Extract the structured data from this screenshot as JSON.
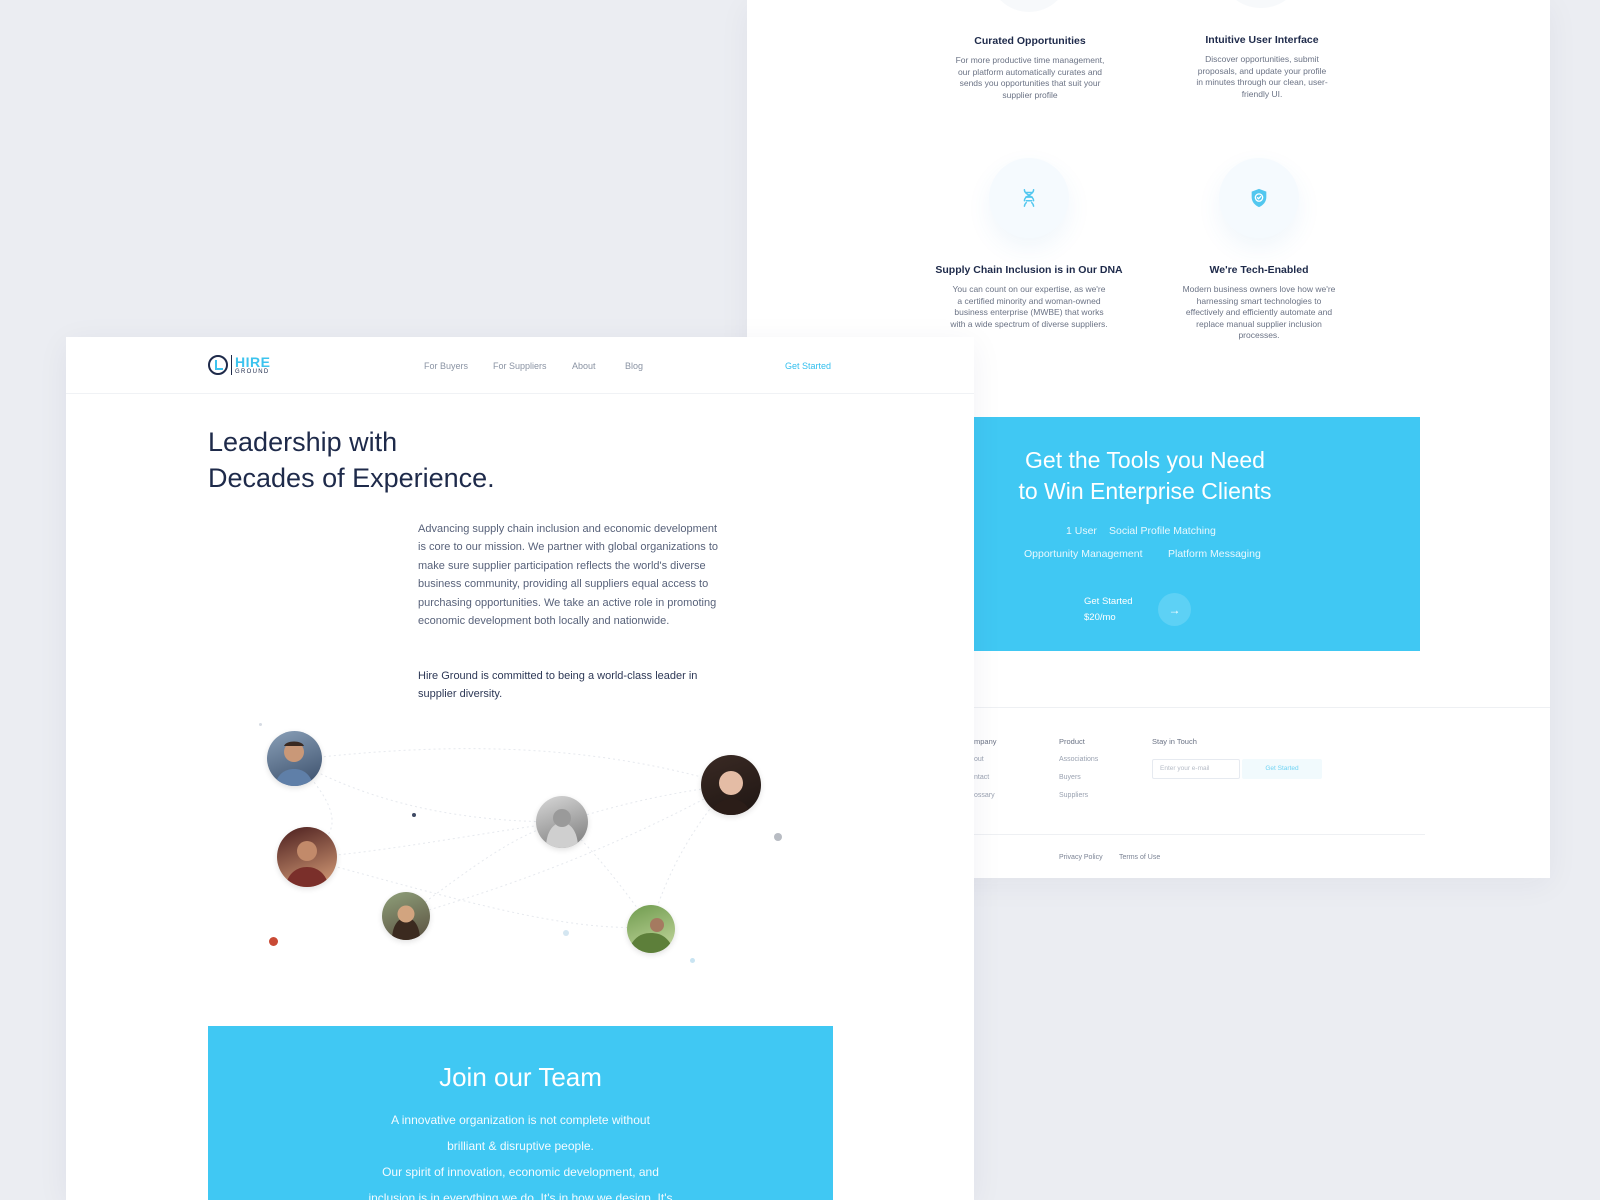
{
  "features": [
    {
      "title": "Curated Opportunities",
      "text": "For more productive time management, our platform automatically curates and sends you opportunities that suit your supplier profile"
    },
    {
      "title": "Intuitive User Interface",
      "text": "Discover opportunities, submit proposals, and update your profile in minutes through our clean, user-friendly UI."
    },
    {
      "title": "Supply Chain Inclusion is in Our DNA",
      "text": "You can count on our expertise, as we're a certified minority and woman-owned business enterprise (MWBE) that works with a wide spectrum of diverse suppliers.",
      "icon": "dna-icon"
    },
    {
      "title": "We're Tech-Enabled",
      "text": "Modern business owners love how we're harnessing smart technologies to effectively and efficiently automate and replace manual supplier inclusion processes.",
      "icon": "shield-check-icon"
    }
  ],
  "cta": {
    "title_line1": "Get the Tools you Need",
    "title_line2": "to Win Enterprise Clients",
    "features_row1": [
      "1 User",
      "Social Profile Matching"
    ],
    "features_row2": [
      "Opportunity Management",
      "Platform Messaging"
    ],
    "button_label": "Get Started",
    "price": "$20/mo",
    "arrow_icon": "arrow-right-icon"
  },
  "footer": {
    "company_title": "mpany",
    "company_links": [
      "out",
      "ntact",
      "ossary"
    ],
    "product_title": "Product",
    "product_links": [
      "Associations",
      "Buyers",
      "Suppliers"
    ],
    "stay_title": "Stay in Touch",
    "email_placeholder": "Enter your e-mail",
    "subscribe_label": "Get Started",
    "legal_links": [
      "Privacy Policy",
      "Terms of Use"
    ]
  },
  "nav": {
    "logo_hire": "HIRE",
    "logo_ground": "GROUND",
    "links": [
      "For Buyers",
      "For Suppliers",
      "About",
      "Blog"
    ],
    "get_started": "Get Started"
  },
  "about": {
    "title_line1": "Leadership with",
    "title_line2": "Decades of Experience.",
    "body": "Advancing supply chain inclusion and economic development is core to our mission. We partner with global organizations to make sure supplier participation reflects the world's diverse business community, providing all suppliers equal access to purchasing opportunities. We take an active role in promoting economic development both locally and nationwide.",
    "commitment": "Hire Ground is committed to being a world-class leader in supplier diversity."
  },
  "join": {
    "title": "Join our Team",
    "line1": "A innovative organization is not complete without",
    "line2": "brilliant & disruptive people.",
    "line3": "Our spirit of innovation, economic development, and",
    "line4": "inclusion is in everything we do. It's in how we design. It's"
  },
  "colors": {
    "accent": "#40c8f3",
    "navy": "#1e2a4a",
    "background": "#ebedf2"
  }
}
